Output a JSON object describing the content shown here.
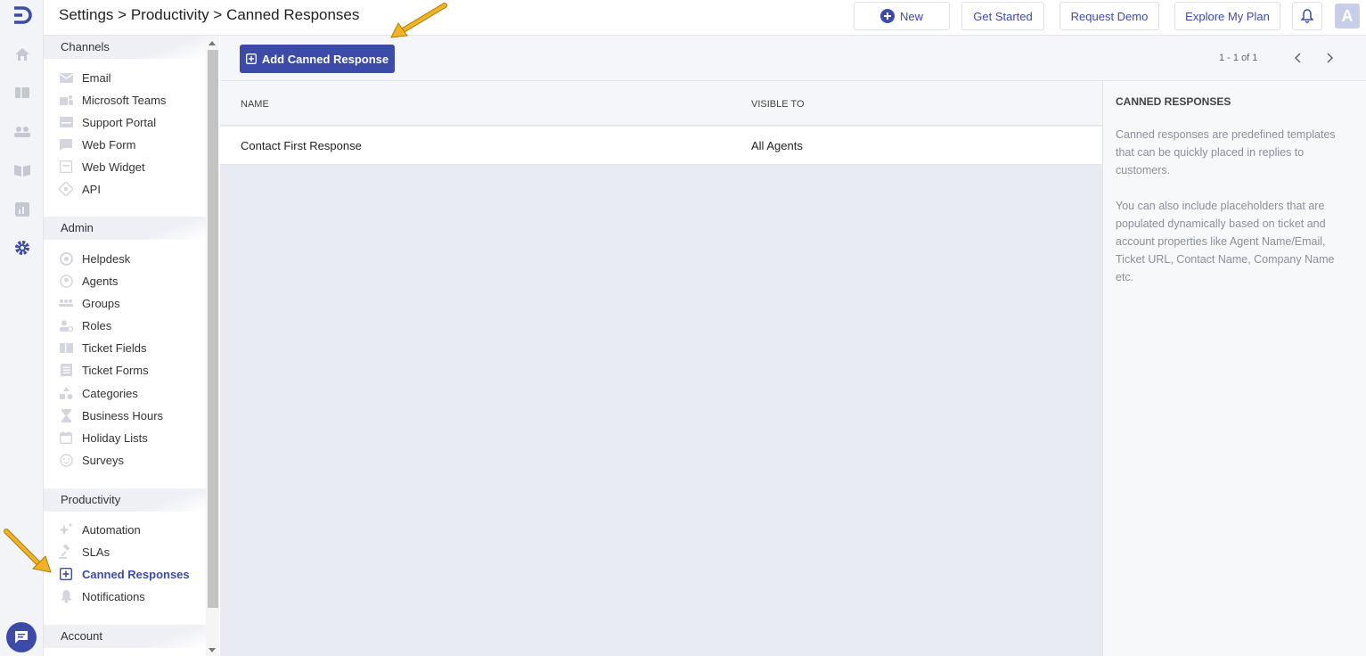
{
  "breadcrumb": {
    "parts": [
      "Settings",
      "Productivity",
      "Canned Responses"
    ],
    "separator": " > "
  },
  "topbar": {
    "new_label": "New",
    "get_started_label": "Get Started",
    "request_demo_label": "Request Demo",
    "explore_plan_label": "Explore My Plan",
    "avatar_letter": "A"
  },
  "rail": {
    "icons": [
      "home-icon",
      "tickets-icon",
      "contacts-icon",
      "knowledge-base-icon",
      "reports-icon",
      "settings-icon"
    ]
  },
  "sidebar": {
    "channels": {
      "title": "Channels",
      "items": [
        {
          "label": "Email",
          "icon": "email-icon"
        },
        {
          "label": "Microsoft Teams",
          "icon": "teams-icon"
        },
        {
          "label": "Support Portal",
          "icon": "portal-icon"
        },
        {
          "label": "Web Form",
          "icon": "web-form-icon"
        },
        {
          "label": "Web Widget",
          "icon": "web-widget-icon"
        },
        {
          "label": "API",
          "icon": "api-icon"
        }
      ]
    },
    "admin": {
      "title": "Admin",
      "items": [
        {
          "label": "Helpdesk",
          "icon": "helpdesk-icon"
        },
        {
          "label": "Agents",
          "icon": "agents-icon"
        },
        {
          "label": "Groups",
          "icon": "groups-icon"
        },
        {
          "label": "Roles",
          "icon": "roles-icon"
        },
        {
          "label": "Ticket Fields",
          "icon": "ticket-fields-icon"
        },
        {
          "label": "Ticket Forms",
          "icon": "ticket-forms-icon"
        },
        {
          "label": "Categories",
          "icon": "categories-icon"
        },
        {
          "label": "Business Hours",
          "icon": "hourglass-icon"
        },
        {
          "label": "Holiday Lists",
          "icon": "calendar-icon"
        },
        {
          "label": "Surveys",
          "icon": "smiley-icon"
        }
      ]
    },
    "productivity": {
      "title": "Productivity",
      "items": [
        {
          "label": "Automation",
          "icon": "sparkle-icon"
        },
        {
          "label": "SLAs",
          "icon": "gavel-icon"
        },
        {
          "label": "Canned Responses",
          "icon": "canned-response-icon",
          "active": true
        },
        {
          "label": "Notifications",
          "icon": "bell-icon"
        }
      ]
    },
    "account": {
      "title": "Account"
    }
  },
  "main": {
    "add_button_label": "Add Canned Response",
    "pagination": "1 - 1 of 1",
    "columns": [
      "NAME",
      "VISIBLE TO"
    ],
    "rows": [
      {
        "name": "Contact First Response",
        "visible_to": "All Agents"
      }
    ]
  },
  "help": {
    "title": "CANNED RESPONSES",
    "paragraphs": [
      "Canned responses are predefined templates that can be quickly placed in replies to customers.",
      "You can also include placeholders that are populated dynamically based on ticket and account properties like Agent Name/Email, Ticket URL, Contact Name, Company Name etc."
    ]
  },
  "colors": {
    "accent": "#3c4ba8",
    "annotation_arrow": "#f0b323"
  }
}
